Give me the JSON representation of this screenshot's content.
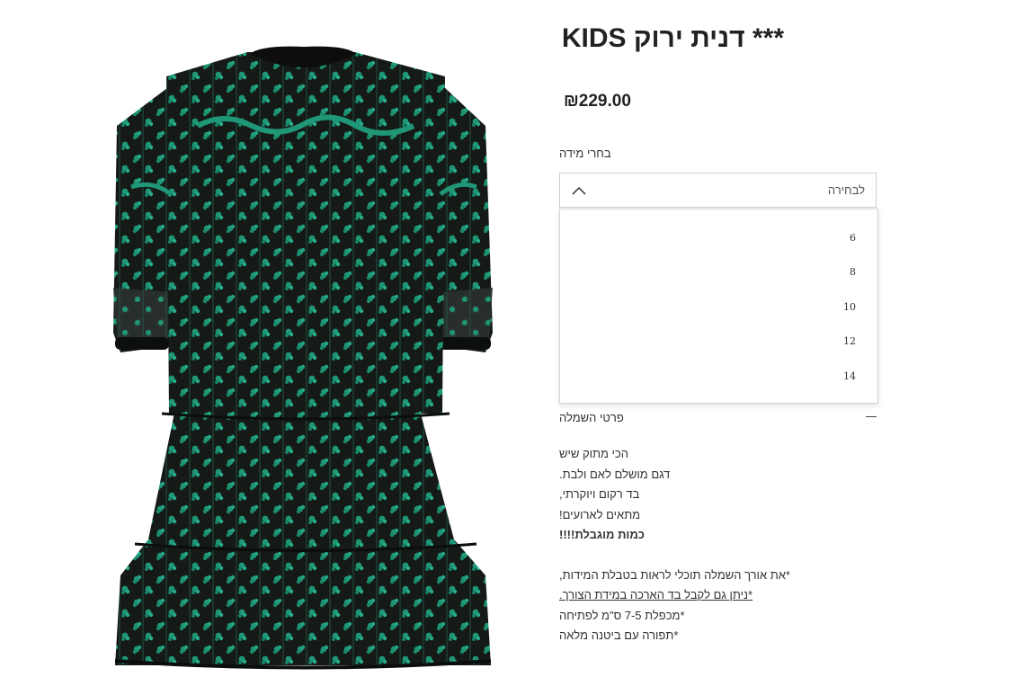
{
  "product": {
    "title": "*** דנית ירוק KIDS",
    "price": "₪229.00",
    "image_icon": "green-embroidered-dress-photo"
  },
  "size": {
    "label": "בחרי מידה",
    "placeholder": "לבחירה",
    "options": [
      "6",
      "8",
      "10",
      "12",
      "14"
    ]
  },
  "details": {
    "label": "פרטי השמלה",
    "lines": [
      "הכי מתוק שיש",
      "דגם מושלם לאם ולבת.",
      "בד רקום ויוקרתי,",
      "מתאים לארועים!",
      "כמות מוגבלת!!!!"
    ],
    "notes": [
      "*את אורך השמלה תוכלי לראות בטבלת המידות,",
      "*ניתן גם לקבל בד הארכה במידת הצורך.",
      "*מכפלת 7-5 ס\"מ לפתיחה",
      "*תפורה עם ביטנה מלאה"
    ]
  },
  "colors": {
    "dress_base": "#141714",
    "embroidery": "#1f9676",
    "text": "#222222"
  }
}
